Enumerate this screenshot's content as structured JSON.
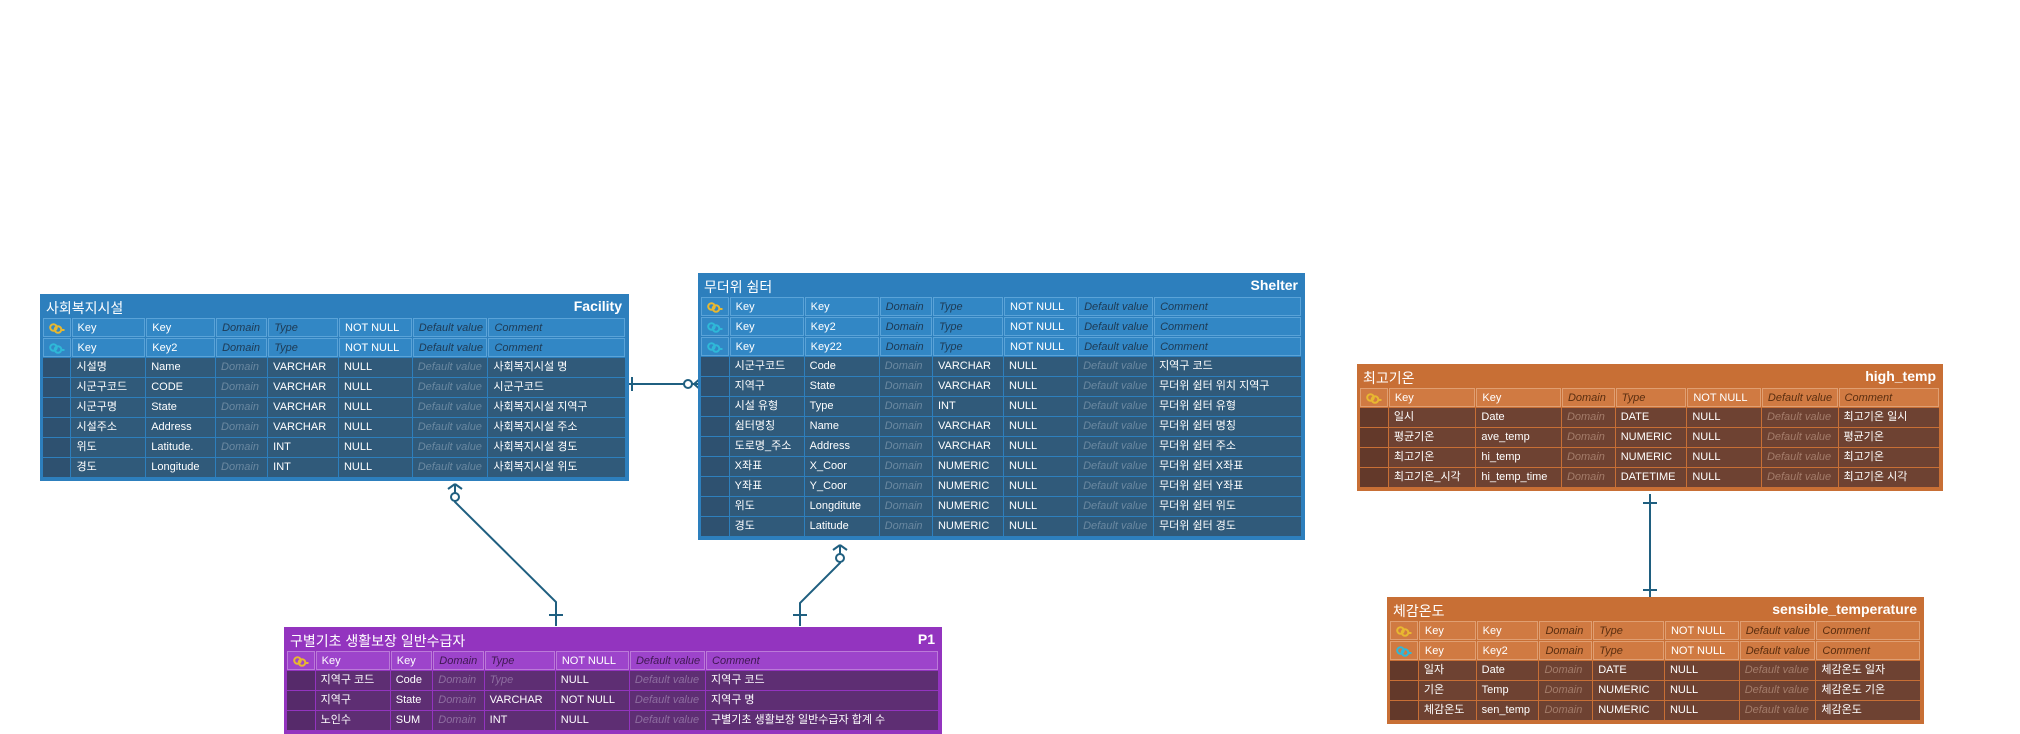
{
  "column_placeholders": {
    "domain": "Domain",
    "type": "Type",
    "default": "Default value",
    "comment": "Comment"
  },
  "entities": {
    "facility": {
      "title": "사회복지시설",
      "code": "Facility",
      "key_rows": [
        {
          "key_icon": "key-icon-primary",
          "logical": "Key",
          "physical": "Key",
          "nullable": "NOT NULL"
        },
        {
          "key_icon": "key-icon-foreign",
          "logical": "Key",
          "physical": "Key2",
          "nullable": "NOT NULL"
        }
      ],
      "rows": [
        {
          "logical": "시설명",
          "physical": "Name",
          "type": "VARCHAR",
          "nullable": "NULL",
          "comment": "사회복지시설 명"
        },
        {
          "logical": "시군구코드",
          "physical": "CODE",
          "type": "VARCHAR",
          "nullable": "NULL",
          "comment": "시군구코드"
        },
        {
          "logical": "시군구명",
          "physical": "State",
          "type": "VARCHAR",
          "nullable": "NULL",
          "comment": "사회복지시설 지역구"
        },
        {
          "logical": "시설주소",
          "physical": "Address",
          "type": "VARCHAR",
          "nullable": "NULL",
          "comment": "사회복지시설 주소"
        },
        {
          "logical": "위도",
          "physical": "Latitude.",
          "type": "INT",
          "nullable": "NULL",
          "comment": "사회복지시설 경도"
        },
        {
          "logical": "경도",
          "physical": "Longitude",
          "type": "INT",
          "nullable": "NULL",
          "comment": "사회복지시설 위도"
        }
      ]
    },
    "shelter": {
      "title": "무더위 쉼터",
      "code": "Shelter",
      "key_rows": [
        {
          "key_icon": "key-icon-primary",
          "logical": "Key",
          "physical": "Key",
          "nullable": "NOT NULL"
        },
        {
          "key_icon": "key-icon-foreign",
          "logical": "Key",
          "physical": "Key2",
          "nullable": "NOT NULL"
        },
        {
          "key_icon": "key-icon-foreign",
          "logical": "Key",
          "physical": "Key22",
          "nullable": "NOT NULL"
        }
      ],
      "rows": [
        {
          "logical": "시군구코드",
          "physical": "Code",
          "type": "VARCHAR",
          "nullable": "NULL",
          "comment": "지역구 코드"
        },
        {
          "logical": "지역구",
          "physical": "State",
          "type": "VARCHAR",
          "nullable": "NULL",
          "comment": "무더위 쉼터 위치 지역구"
        },
        {
          "logical": "시설 유형",
          "physical": "Type",
          "type": "INT",
          "nullable": "NULL",
          "comment": "무더위 쉼터 유형"
        },
        {
          "logical": "쉼터명칭",
          "physical": "Name",
          "type": "VARCHAR",
          "nullable": "NULL",
          "comment": "무더위 쉼터 명칭"
        },
        {
          "logical": "도로명_주소",
          "physical": "Address",
          "type": "VARCHAR",
          "nullable": "NULL",
          "comment": "무더위 쉼터 주소"
        },
        {
          "logical": "X좌표",
          "physical": "X_Coor",
          "type": "NUMERIC",
          "nullable": "NULL",
          "comment": "무더위 쉼터 X좌표"
        },
        {
          "logical": "Y좌표",
          "physical": "Y_Coor",
          "type": "NUMERIC",
          "nullable": "NULL",
          "comment": "무더위 쉼터 Y좌표"
        },
        {
          "logical": "위도",
          "physical": "Longditute",
          "type": "NUMERIC",
          "nullable": "NULL",
          "comment": "무더위 쉼터 위도"
        },
        {
          "logical": "경도",
          "physical": "Latitude",
          "type": "NUMERIC",
          "nullable": "NULL",
          "comment": "무더위 쉼터 경도"
        }
      ]
    },
    "p1": {
      "title": "구별기초 생활보장 일반수급자",
      "code": "P1",
      "key_rows": [
        {
          "key_icon": "key-icon-primary",
          "logical": "Key",
          "physical": "Key",
          "nullable": "NOT NULL"
        }
      ],
      "rows": [
        {
          "logical": "지역구 코드",
          "physical": "Code",
          "type": "",
          "nullable": "NULL",
          "comment": "지역구 코드"
        },
        {
          "logical": "지역구",
          "physical": "State",
          "type": "VARCHAR",
          "nullable": "NOT NULL",
          "comment": "지역구 명"
        },
        {
          "logical": "노인수",
          "physical": "SUM",
          "type": "INT",
          "nullable": "NULL",
          "comment": "구별기초 생활보장 일반수급자 합계 수"
        }
      ]
    },
    "high_temp": {
      "title": "최고기온",
      "code": "high_temp",
      "key_rows": [
        {
          "key_icon": "key-icon-primary",
          "logical": "Key",
          "physical": "Key",
          "nullable": "NOT NULL"
        }
      ],
      "rows": [
        {
          "logical": "일시",
          "physical": "Date",
          "type": "DATE",
          "nullable": "NULL",
          "comment": "최고기온 일시"
        },
        {
          "logical": "평균기온",
          "physical": "ave_temp",
          "type": "NUMERIC",
          "nullable": "NULL",
          "comment": "평균기온"
        },
        {
          "logical": "최고기온",
          "physical": "hi_temp",
          "type": "NUMERIC",
          "nullable": "NULL",
          "comment": "최고기온"
        },
        {
          "logical": "최고기온_시각",
          "physical": "hi_temp_time",
          "type": "DATETIME",
          "nullable": "NULL",
          "comment": "최고기온 시각"
        }
      ]
    },
    "sensible_temperature": {
      "title": "체감온도",
      "code": "sensible_temperature",
      "key_rows": [
        {
          "key_icon": "key-icon-primary",
          "logical": "Key",
          "physical": "Key",
          "nullable": "NOT NULL"
        },
        {
          "key_icon": "key-icon-foreign",
          "logical": "Key",
          "physical": "Key2",
          "nullable": "NOT NULL"
        }
      ],
      "rows": [
        {
          "logical": "일자",
          "physical": "Date",
          "type": "DATE",
          "nullable": "NULL",
          "comment": "체감온도 일자"
        },
        {
          "logical": "기온",
          "physical": "Temp",
          "type": "NUMERIC",
          "nullable": "NULL",
          "comment": "체감온도 기온"
        },
        {
          "logical": "체감온도",
          "physical": "sen_temp",
          "type": "NUMERIC",
          "nullable": "NULL",
          "comment": "체감온도"
        }
      ]
    }
  },
  "relationships": [
    {
      "from": "facility",
      "to": "shelter",
      "from_end": "one",
      "to_end": "zero-or-many"
    },
    {
      "from": "facility",
      "to": "p1",
      "from_end": "zero-or-many",
      "to_end": "one"
    },
    {
      "from": "shelter",
      "to": "p1",
      "from_end": "zero-or-many",
      "to_end": "one"
    },
    {
      "from": "high_temp",
      "to": "sensible_temperature",
      "from_end": "one",
      "to_end": "one"
    }
  ],
  "colors": {
    "facility": "#2d7fbd",
    "shelter": "#2d7fbd",
    "p1": "#9334bf",
    "high_temp": "#c86f35",
    "sensible_temperature": "#c86f35",
    "connector": "#1f5f80",
    "primary_key_icon": "#e8b830",
    "foreign_key_icon": "#2fb8d8"
  }
}
